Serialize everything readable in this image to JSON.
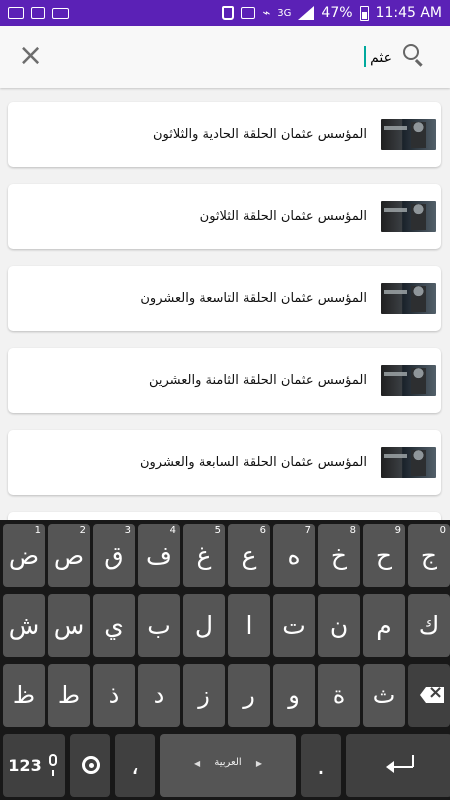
{
  "status": {
    "battery": "47%",
    "time": "11:45 AM",
    "network": "3G"
  },
  "search": {
    "value": "عثم"
  },
  "results": [
    {
      "title": "المؤسس عثمان الحلقة الحادية والثلاثون"
    },
    {
      "title": "المؤسس عثمان الحلقة الثلاثون"
    },
    {
      "title": "المؤسس عثمان الحلقة التاسعة والعشرون"
    },
    {
      "title": "المؤسس عثمان الحلقة الثامنة والعشرين"
    },
    {
      "title": "المؤسس عثمان الحلقة السابعة والعشرون"
    }
  ],
  "keyboard": {
    "row1": [
      {
        "label": "ض",
        "num": "1"
      },
      {
        "label": "ص",
        "num": "2"
      },
      {
        "label": "ق",
        "num": "3"
      },
      {
        "label": "ف",
        "num": "4"
      },
      {
        "label": "غ",
        "num": "5"
      },
      {
        "label": "ع",
        "num": "6"
      },
      {
        "label": "ه",
        "num": "7"
      },
      {
        "label": "خ",
        "num": "8"
      },
      {
        "label": "ح",
        "num": "9"
      },
      {
        "label": "ج",
        "num": "0"
      }
    ],
    "row2": [
      "ش",
      "س",
      "ي",
      "ب",
      "ل",
      "ا",
      "ت",
      "ن",
      "م",
      "ك"
    ],
    "row3": [
      "ظ",
      "ط",
      "ذ",
      "د",
      "ز",
      "ر",
      "و",
      "ة",
      "ث"
    ],
    "bottom": {
      "numbers": "123",
      "comma": "،",
      "space": "العربية",
      "period": "."
    }
  },
  "colors": {
    "status_bar": "#5b21b6",
    "keyboard_background": "#181818",
    "key_background": "#555555",
    "cursor": "#00a99d"
  }
}
